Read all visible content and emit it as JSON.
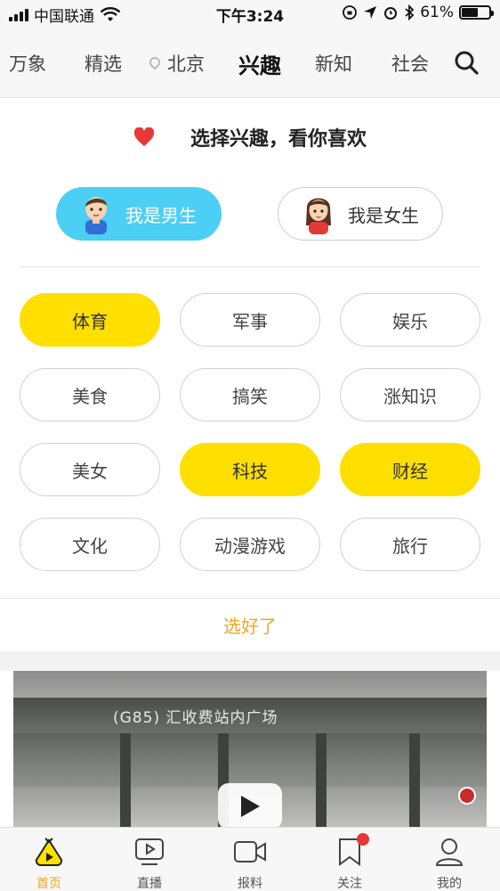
{
  "status_bar": {
    "carrier": "中国联通",
    "time": "下午3:24",
    "battery_percent": "61%",
    "battery_level": 0.61
  },
  "top_tabs": [
    {
      "label": "万象"
    },
    {
      "label": "精选"
    },
    {
      "label": "北京"
    },
    {
      "label": "兴趣",
      "active": true
    },
    {
      "label": "新知"
    },
    {
      "label": "社会"
    }
  ],
  "interest": {
    "title": "选择兴趣，看你喜欢",
    "gender_male": "我是男生",
    "gender_female": "我是女生",
    "tags": [
      {
        "label": "体育",
        "selected": true
      },
      {
        "label": "军事",
        "selected": false
      },
      {
        "label": "娱乐",
        "selected": false
      },
      {
        "label": "美食",
        "selected": false
      },
      {
        "label": "搞笑",
        "selected": false
      },
      {
        "label": "涨知识",
        "selected": false
      },
      {
        "label": "美女",
        "selected": false
      },
      {
        "label": "科技",
        "selected": true
      },
      {
        "label": "财经",
        "selected": true
      },
      {
        "label": "文化",
        "selected": false
      },
      {
        "label": "动漫游戏",
        "selected": false
      },
      {
        "label": "旅行",
        "selected": false
      }
    ],
    "confirm_label": "选好了"
  },
  "video": {
    "sign_text": "(G85) 汇收费站内广场"
  },
  "bottom_nav": [
    {
      "label": "首页",
      "icon": "home-play-icon",
      "active": true
    },
    {
      "label": "直播",
      "icon": "live-tv-icon"
    },
    {
      "label": "报料",
      "icon": "video-camera-icon"
    },
    {
      "label": "关注",
      "icon": "bookmark-icon",
      "badge": true
    },
    {
      "label": "我的",
      "icon": "user-icon"
    }
  ],
  "colors": {
    "accent_yellow": "#ffdf00",
    "male_blue": "#4ccff5",
    "active_orange": "#f0a623",
    "heart_red": "#e53935"
  }
}
